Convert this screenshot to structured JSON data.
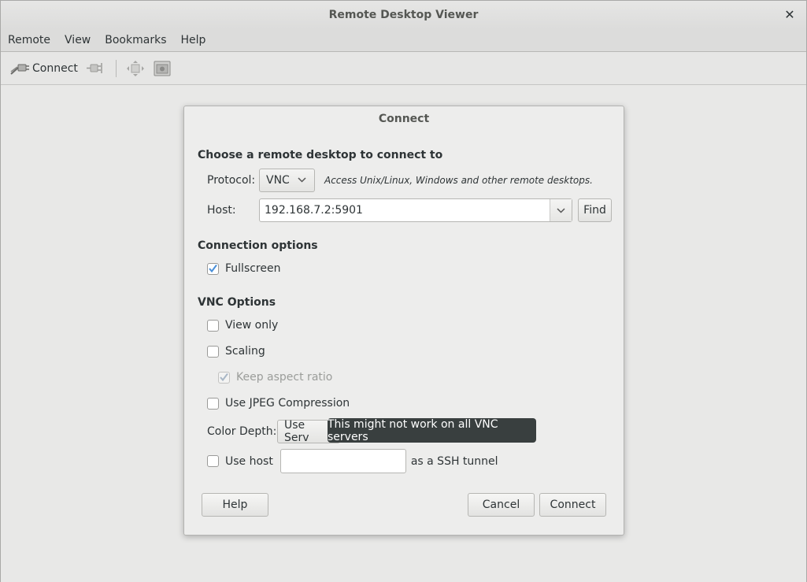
{
  "window": {
    "title": "Remote Desktop Viewer",
    "close_glyph": "✕"
  },
  "menu": {
    "items": [
      "Remote",
      "View",
      "Bookmarks",
      "Help"
    ]
  },
  "toolbar": {
    "connect_label": "Connect",
    "icons": [
      "connect-icon",
      "disconnect-icon",
      "fullscreen-icon",
      "screenshot-icon"
    ]
  },
  "dialog": {
    "title": "Connect",
    "choose_heading": "Choose a remote desktop to connect to",
    "protocol_label": "Protocol:",
    "protocol_value": "VNC",
    "protocol_hint": "Access Unix/Linux, Windows and other remote desktops.",
    "host_label": "Host:",
    "host_value": "192.168.7.2:5901",
    "find_label": "Find",
    "connection_heading": "Connection options",
    "fullscreen_label": "Fullscreen",
    "fullscreen_checked": true,
    "vnc_heading": "VNC Options",
    "view_only_label": "View only",
    "scaling_label": "Scaling",
    "keep_aspect_label": "Keep aspect ratio",
    "jpeg_label": "Use JPEG Compression",
    "color_depth_label": "Color Depth:",
    "color_depth_value": "Use Serv",
    "use_host_label": "Use host",
    "ssh_suffix": "as a SSH tunnel",
    "help_label": "Help",
    "cancel_label": "Cancel",
    "connect_label": "Connect"
  },
  "tooltip": {
    "text": "This might not work on all VNC servers"
  },
  "colors": {
    "check_accent": "#4a90d9",
    "tooltip_bg": "#393f3f"
  }
}
